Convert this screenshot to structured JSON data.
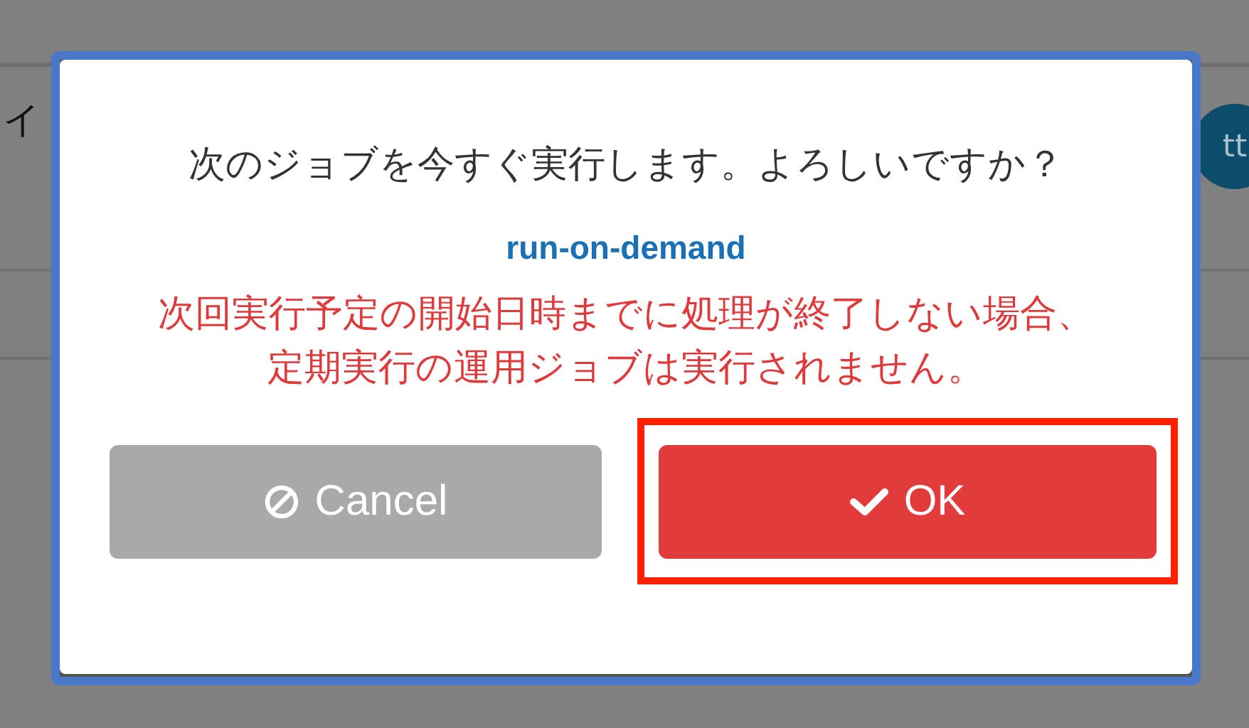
{
  "background": {
    "row_label": "イ",
    "avatar": "tt"
  },
  "dialog": {
    "message": "次のジョブを今すぐ実行します。よろしいですか？",
    "job_name": "run-on-demand",
    "warning": "次回実行予定の開始日時までに処理が終了しない場合、定期実行の運用ジョブは実行されません。",
    "buttons": [
      {
        "kind": "cancel",
        "label": "Cancel",
        "highlighted": false
      },
      {
        "kind": "ok",
        "label": "OK",
        "highlighted": true
      }
    ]
  }
}
